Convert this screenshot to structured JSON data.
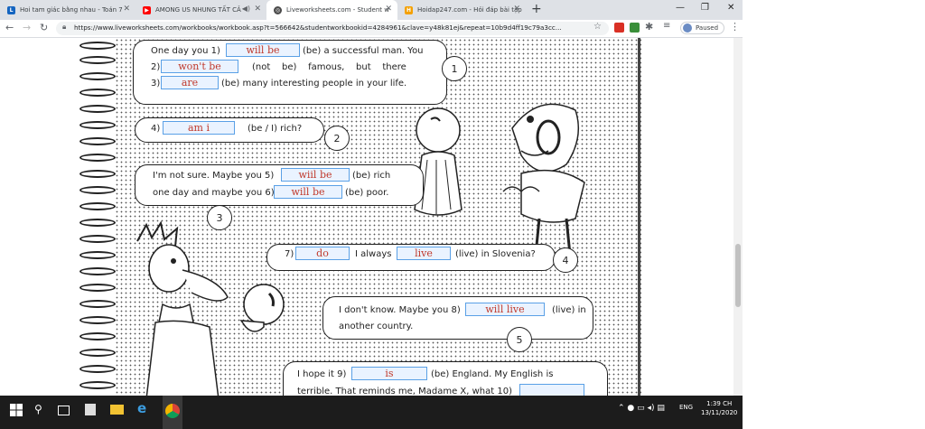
{
  "browser": {
    "tabs": [
      {
        "title": "Hoi tam giác bằng nhau - Toán 7",
        "favicon_color": "#1565c0",
        "favicon_letter": "L",
        "active": false
      },
      {
        "title": "AMONG US NHUNG TẤT CẢ",
        "favicon_color": "#ff0000",
        "favicon_letter": "▶",
        "active": false
      },
      {
        "title": "Liveworksheets.com - Student w",
        "favicon_color": "#4a4a4a",
        "favicon_letter": "◎",
        "active": true
      },
      {
        "title": "Hoidap247.com - Hỏi đáp bài tập",
        "favicon_color": "#f4a000",
        "favicon_letter": "H",
        "active": false
      }
    ],
    "new_tab": "+",
    "url": "https://www.liveworksheets.com/workbooks/workbook.asp?t=566642&studentworkbookid=4284961&clave=y48k81ej&repeat=10b9d4ff19c79a3cc...",
    "profile_status": "Paused"
  },
  "worksheet": {
    "bubble1": {
      "line1_pre": "One day you 1)",
      "ans1": "will be",
      "line1_post": "(be) a successful man. You",
      "line2_pre": "2)",
      "ans2": "won't be",
      "line2_post": "(not    be)    famous,    but    there",
      "line3_pre": "3)",
      "ans3": "are",
      "line3_post": "(be) many interesting people in your life.",
      "number": "1"
    },
    "bubble2": {
      "pre": "4)",
      "ans4": "am i",
      "post": "(be / I) rich?",
      "number": "2"
    },
    "bubble3": {
      "line1_pre": "I'm not sure. Maybe you 5)",
      "ans5": "wiil be",
      "line1_post": "(be) rich",
      "line2_pre": "one day and maybe you 6)",
      "ans6": "will be",
      "line2_post": "(be) poor.",
      "number": "3"
    },
    "bubble4": {
      "pre": "7)",
      "ans7": "do",
      "mid": "I always",
      "ans_live": "live",
      "post": "(live) in Slovenia?",
      "number": "4"
    },
    "bubble5": {
      "line1_pre": "I don't know. Maybe you 8)",
      "ans8": "will live",
      "line1_post": "(live) in",
      "line2": "another country.",
      "number": "5"
    },
    "bubble6": {
      "line1_pre": "I hope it 9)",
      "ans9": "is",
      "line1_post": "(be) England. My English is",
      "line2_pre": "terrible. That reminds me, Madame X, what 10)",
      "ans10": ""
    }
  },
  "taskbar": {
    "time": "1:39 CH",
    "date": "13/11/2020",
    "language": "ENG"
  }
}
